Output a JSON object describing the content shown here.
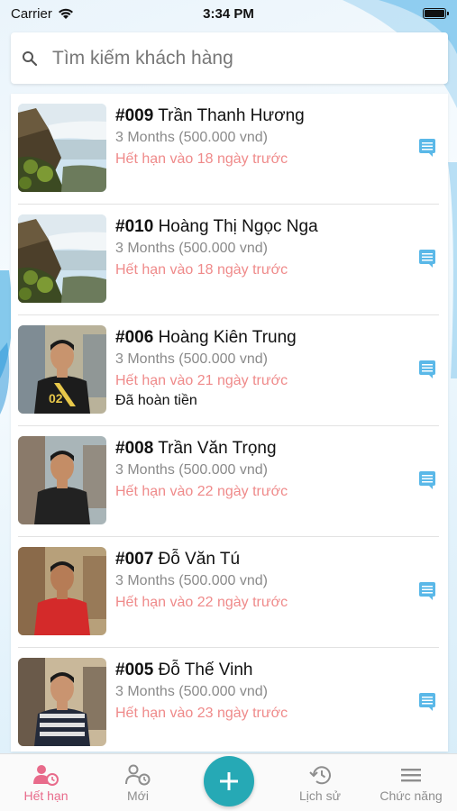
{
  "status_bar": {
    "carrier": "Carrier",
    "time": "3:34 PM"
  },
  "search": {
    "placeholder": "Tìm kiếm khách hàng",
    "value": ""
  },
  "customers": [
    {
      "code": "#009",
      "name": "Trần Thanh Hương",
      "plan": "3 Months (500.000 vnd)",
      "expiry": "Hết hạn vào 18 ngày trước",
      "refund": "",
      "avatar": "waterfall-photo"
    },
    {
      "code": "#010",
      "name": "Hoàng Thị Ngọc Nga",
      "plan": "3 Months (500.000 vnd)",
      "expiry": "Hết hạn vào 18 ngày trước",
      "refund": "",
      "avatar": "waterfall-photo"
    },
    {
      "code": "#006",
      "name": "Hoàng Kiên Trung",
      "plan": "3 Months (500.000 vnd)",
      "expiry": "Hết hạn vào 21 ngày trước",
      "refund": "Đã hoàn tiền",
      "avatar": "person-photo"
    },
    {
      "code": "#008",
      "name": "Trần Văn Trọng",
      "plan": "3 Months (500.000 vnd)",
      "expiry": "Hết hạn vào 22 ngày trước",
      "refund": "",
      "avatar": "person-photo"
    },
    {
      "code": "#007",
      "name": "Đỗ Văn Tú",
      "plan": "3 Months (500.000 vnd)",
      "expiry": "Hết hạn vào 22 ngày trước",
      "refund": "",
      "avatar": "person-photo"
    },
    {
      "code": "#005",
      "name": "Đỗ Thế Vinh",
      "plan": "3 Months (500.000 vnd)",
      "expiry": "Hết hạn vào 23 ngày trước",
      "refund": "",
      "avatar": "person-photo"
    }
  ],
  "tabs": [
    {
      "label": "Hết hạn",
      "icon": "person-clock-icon",
      "active": true
    },
    {
      "label": "Mới",
      "icon": "person-new-icon",
      "active": false
    },
    {
      "label": "Lịch sử",
      "icon": "history-icon",
      "active": false
    },
    {
      "label": "Chức năng",
      "icon": "menu-icon",
      "active": false
    }
  ],
  "fab": {
    "icon": "plus-icon"
  },
  "colors": {
    "accent": "#26a9b5",
    "active_tab": "#e86b8b",
    "expiry_text": "#ef8a8a",
    "note_icon": "#5ab8e8"
  }
}
